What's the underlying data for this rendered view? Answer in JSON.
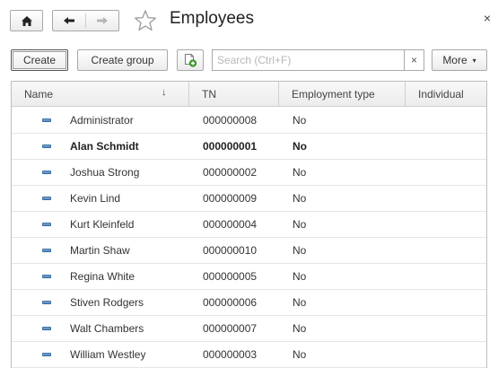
{
  "window": {
    "title": "Employees",
    "close_glyph": "×"
  },
  "toolbar": {
    "create_label": "Create",
    "create_group_label": "Create group",
    "search_placeholder": "Search (Ctrl+F)",
    "search_value": "",
    "clear_glyph": "×",
    "more_label": "More",
    "more_caret": "▾"
  },
  "icons": {
    "home": "home-icon",
    "back": "arrow-left-icon",
    "forward": "arrow-right-icon",
    "favorite": "star-icon",
    "copy": "copy-document-icon",
    "row": "element-dash-icon"
  },
  "table": {
    "columns": [
      "Name",
      "TN",
      "Employment type",
      "Individual"
    ],
    "sort_indicator": "↓",
    "rows": [
      {
        "name": "Administrator",
        "tn": "000000008",
        "employment": "No",
        "bold": false
      },
      {
        "name": "Alan Schmidt",
        "tn": "000000001",
        "employment": "No",
        "bold": true
      },
      {
        "name": "Joshua Strong",
        "tn": "000000002",
        "employment": "No",
        "bold": false
      },
      {
        "name": "Kevin Lind",
        "tn": "000000009",
        "employment": "No",
        "bold": false
      },
      {
        "name": "Kurt Kleinfeld",
        "tn": "000000004",
        "employment": "No",
        "bold": false
      },
      {
        "name": "Martin Shaw",
        "tn": "000000010",
        "employment": "No",
        "bold": false
      },
      {
        "name": "Regina White",
        "tn": "000000005",
        "employment": "No",
        "bold": false
      },
      {
        "name": "Stiven Rodgers",
        "tn": "000000006",
        "employment": "No",
        "bold": false
      },
      {
        "name": "Walt Chambers",
        "tn": "000000007",
        "employment": "No",
        "bold": false
      },
      {
        "name": "William Westley",
        "tn": "000000003",
        "employment": "No",
        "bold": false
      }
    ]
  },
  "colors": {
    "accent_dash": "#4a7bb0",
    "border": "#a9a9a9"
  }
}
